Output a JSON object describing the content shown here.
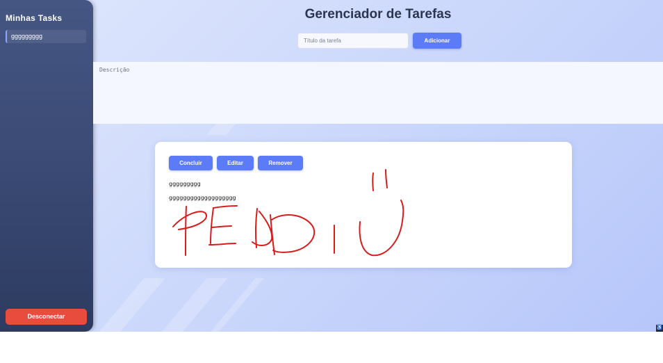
{
  "sidebar": {
    "title": "Minhas Tasks",
    "tasks": [
      {
        "label": "ggggggggg"
      }
    ],
    "logout_label": "Desconectar"
  },
  "header": {
    "title": "Gerenciador de Tarefas",
    "title_placeholder": "Título da tarefa",
    "add_label": "Adicionar"
  },
  "description": {
    "placeholder": "Descrição"
  },
  "task_card": {
    "complete_label": "Concluir",
    "edit_label": "Editar",
    "remove_label": "Remover",
    "title": "ggggggggg",
    "description": "ggggggggggggggggggg"
  },
  "colors": {
    "accent": "#5b7cf6",
    "danger": "#e84c3d",
    "sidebar": "#3a4a74",
    "handwriting": "#d61c1c"
  },
  "icons": {
    "corner": "accessibility-icon"
  }
}
